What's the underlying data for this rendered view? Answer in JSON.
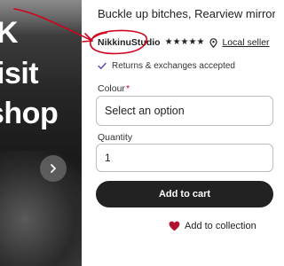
{
  "image_panel": {
    "decal_lines": [
      "K",
      "isit",
      "shop"
    ],
    "next_icon": "chevron-right-icon"
  },
  "listing": {
    "title": "Buckle up bitches, Rearview mirror deco",
    "shop_name": "NikkinuStudio",
    "rating_stars": 5,
    "star_glyph": "★",
    "location_icon": "map-pin-icon",
    "local_seller_label": "Local seller",
    "returns_text": "Returns & exchanges accepted"
  },
  "colour": {
    "label": "Colour",
    "required_marker": "*",
    "selected_value": "Select an option"
  },
  "quantity": {
    "label": "Quantity",
    "value": "1"
  },
  "actions": {
    "add_to_cart_label": "Add to cart",
    "add_to_collection_label": "Add to collection"
  },
  "colors": {
    "annotation_red": "#d0021b",
    "button_dark": "#222222",
    "heart_red": "#b3122e"
  }
}
